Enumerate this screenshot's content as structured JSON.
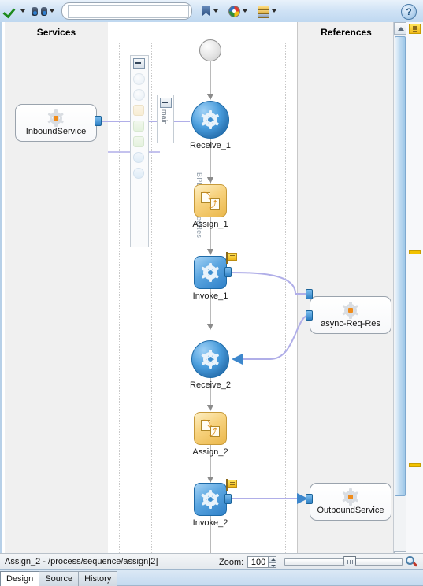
{
  "toolbar": {
    "validate_icon": "green-check-icon",
    "search_icon": "binoculars-icon",
    "search_placeholder": "",
    "search_value": "",
    "bookmark_icon": "bookmark-icon",
    "palette_icon": "color-palette-icon",
    "stack_icon": "layers-icon",
    "help_label": "?"
  },
  "editor": {
    "lanes": {
      "services_title": "Services",
      "references_title": "References"
    },
    "activity_strip": {
      "collapse_label": "−",
      "vertical_label": "BPELAsyncReqRes"
    },
    "scope": {
      "collapse_label": "−",
      "label": "main"
    },
    "services": [
      {
        "name": "InboundService",
        "icon": "service-gear-icon"
      }
    ],
    "references": [
      {
        "name": "async-Req-Res",
        "icon": "service-gear-icon"
      },
      {
        "name": "OutboundService",
        "icon": "service-gear-icon"
      }
    ],
    "flow": [
      {
        "id": "start",
        "label": "",
        "shape": "start-circle"
      },
      {
        "id": "receive1",
        "label": "Receive_1",
        "shape": "circle-blue",
        "icon": "gear-icon"
      },
      {
        "id": "assign1",
        "label": "Assign_1",
        "shape": "square-gold",
        "icon": "assign-icon"
      },
      {
        "id": "invoke1",
        "label": "Invoke_1",
        "shape": "square-blue",
        "icon": "gear-icon",
        "badge": "flag-icon"
      },
      {
        "id": "receive2",
        "label": "Receive_2",
        "shape": "circle-blue",
        "icon": "gear-icon"
      },
      {
        "id": "assign2",
        "label": "Assign_2",
        "shape": "square-gold",
        "icon": "assign-icon"
      },
      {
        "id": "invoke2",
        "label": "Invoke_2",
        "shape": "square-blue",
        "icon": "gear-icon",
        "badge": "flag-icon"
      }
    ],
    "colors": {
      "activity_blue": "#2f80c8",
      "activity_gold": "#eab74b",
      "link_purple": "#b0aee8",
      "flag_yellow": "#f0b81a"
    }
  },
  "statusbar": {
    "path": "Assign_2 - /process/sequence/assign[2]",
    "zoom_label": "Zoom:",
    "zoom_value": "100",
    "zoom_glass_icon": "zoom-magnifier-icon"
  },
  "tabs": [
    {
      "label": "Design",
      "active": true
    },
    {
      "label": "Source",
      "active": false
    },
    {
      "label": "History",
      "active": false
    }
  ]
}
